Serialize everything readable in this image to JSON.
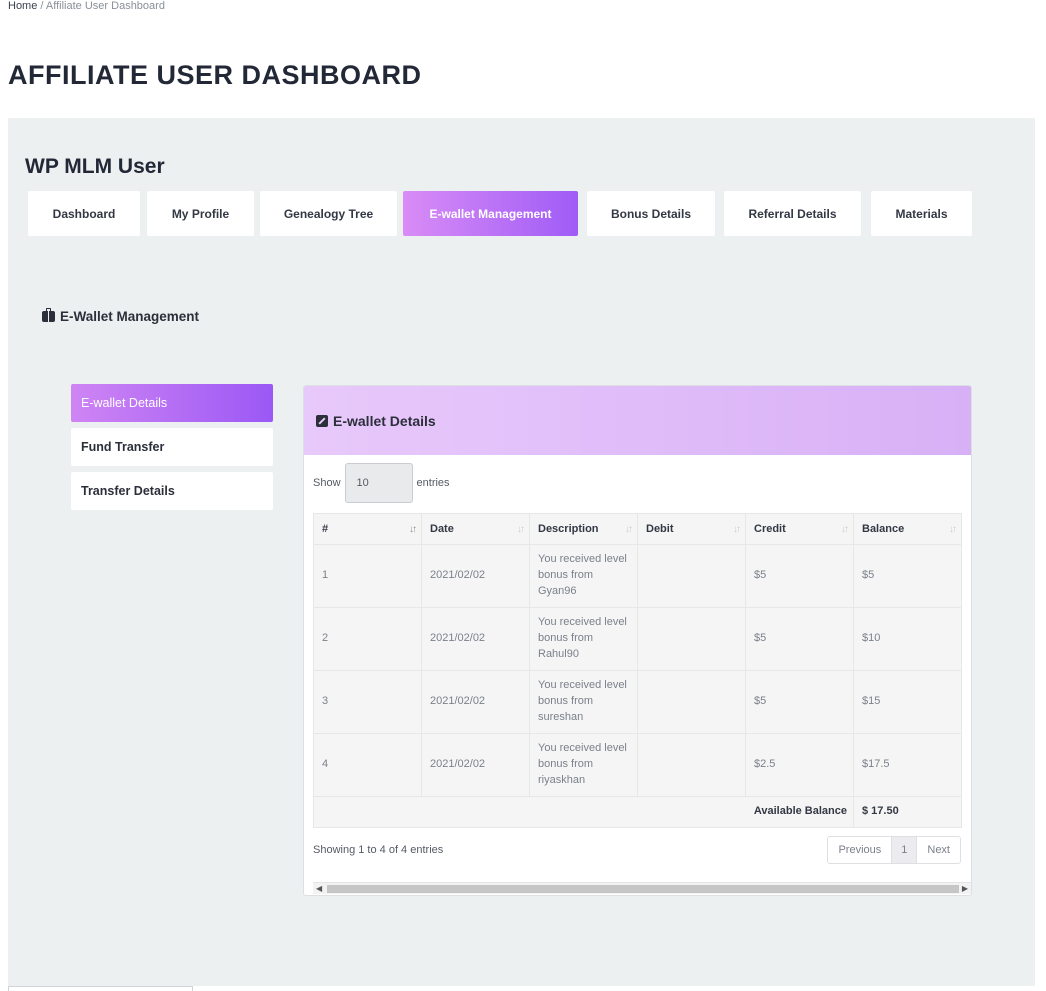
{
  "breadcrumb": {
    "home": "Home",
    "separator": "/",
    "current": "Affiliate User Dashboard"
  },
  "page_title": "AFFILIATE USER DASHBOARD",
  "brand": "WP MLM User",
  "tabs": [
    {
      "label": "Dashboard",
      "active": false
    },
    {
      "label": "My Profile",
      "active": false
    },
    {
      "label": "Genealogy Tree",
      "active": false
    },
    {
      "label": "E-wallet Management",
      "active": true
    },
    {
      "label": "Bonus Details",
      "active": false
    },
    {
      "label": "Referral Details",
      "active": false
    },
    {
      "label": "Materials",
      "active": false
    }
  ],
  "section": {
    "title": "E-Wallet Management",
    "icon": "briefcase-icon"
  },
  "side_menu": [
    {
      "label": "E-wallet Details",
      "active": true
    },
    {
      "label": "Fund Transfer",
      "active": false
    },
    {
      "label": "Transfer Details",
      "active": false
    }
  ],
  "card": {
    "title": "E-wallet Details",
    "icon": "edit-square-icon",
    "length": {
      "show": "Show",
      "value": "10",
      "entries": "entries"
    },
    "columns": [
      "#",
      "Date",
      "Description",
      "Debit",
      "Credit",
      "Balance"
    ],
    "rows": [
      {
        "num": "1",
        "date": "2021/02/02",
        "description": "You received level bonus from Gyan96",
        "debit": "",
        "credit": "$5",
        "balance": "$5"
      },
      {
        "num": "2",
        "date": "2021/02/02",
        "description": "You received level bonus from Rahul90",
        "debit": "",
        "credit": "$5",
        "balance": "$10"
      },
      {
        "num": "3",
        "date": "2021/02/02",
        "description": "You received level bonus from sureshan",
        "debit": "",
        "credit": "$5",
        "balance": "$15"
      },
      {
        "num": "4",
        "date": "2021/02/02",
        "description": "You received level bonus from riyaskhan",
        "debit": "",
        "credit": "$2.5",
        "balance": "$17.5"
      }
    ],
    "available_balance_label": "Available Balance",
    "available_balance_value": "$ 17.50",
    "info": "Showing 1 to 4 of 4 entries",
    "pager": {
      "previous": "Previous",
      "page": "1",
      "next": "Next"
    }
  },
  "colors": {
    "accent_start": "#d98cf6",
    "accent_end": "#9f5cf6",
    "panel_bg": "#edf0f1",
    "card_head": "#e8c9fb"
  }
}
